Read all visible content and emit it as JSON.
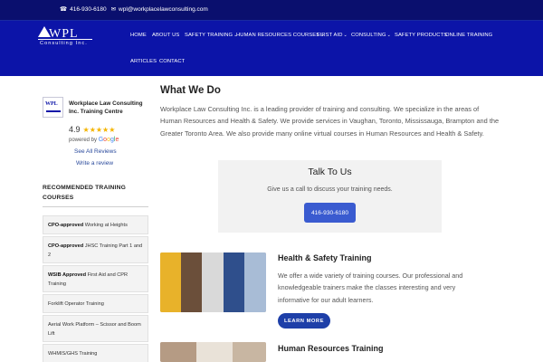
{
  "topbar": {
    "phone": "416-930-6180",
    "email": "wpl@workplacelawconsulting.com"
  },
  "logo": {
    "mark": "WPL",
    "subtitle": "Consulting Inc."
  },
  "nav": {
    "items": [
      {
        "label": "HOME"
      },
      {
        "label": "ABOUT US"
      },
      {
        "label": "SAFETY TRAINING"
      },
      {
        "label": "HUMAN RESOURCES COURSES"
      },
      {
        "label": "FIRST AID"
      },
      {
        "label": "CONSULTING"
      },
      {
        "label": "SAFETY PRODUCTS"
      },
      {
        "label": "ONLINE TRAINING"
      },
      {
        "label": "ARTICLES"
      },
      {
        "label": "CONTACT"
      }
    ]
  },
  "google_widget": {
    "business_name": "Workplace Law Consulting Inc. Training Centre",
    "rating": "4.9",
    "stars": "★★★★★",
    "powered_by": "powered by",
    "google": [
      "G",
      "o",
      "o",
      "g",
      "l",
      "e"
    ],
    "see_all": "See All Reviews",
    "write_review": "Write a review"
  },
  "sidebar": {
    "title": "RECOMMENDED TRAINING COURSES",
    "courses": [
      {
        "bold": "CPO-approved",
        "text": " Working at Heights"
      },
      {
        "bold": "CPO-approved",
        "text": " JHSC Training Part 1 and 2"
      },
      {
        "bold": "WSIB Approved",
        "text": " First Aid and CPR Training"
      },
      {
        "bold": "",
        "text": "Forklift Operator Training"
      },
      {
        "bold": "",
        "text": "Aerial Work Platform – Scissor and Boom Lift"
      },
      {
        "bold": "",
        "text": "WHMIS/GHS Training"
      }
    ]
  },
  "main": {
    "title": "What We Do",
    "intro": "Workplace Law Consulting Inc. is a leading provider of training and consulting. We specialize in the areas of Human Resources and Health & Safety. We provide services in Vaughan, Toronto, Mississauga, Brampton and the Greater Toronto Area. We also provide many online virtual courses in Human Resources and Health & Safety.",
    "talk": {
      "heading": "Talk To Us",
      "text": "Give us a call to discuss your training needs.",
      "button": "416-930-6180"
    },
    "services": [
      {
        "title": "Health & Safety Training",
        "description": "We offer a wide variety of training courses. Our professional and knowledgeable trainers make the classes interesting and very informative for our adult learners.",
        "button": "LEARN MORE"
      },
      {
        "title": "Human Resources Training"
      }
    ]
  },
  "colors": {
    "topbar": "#0a0f6e",
    "navbar": "#0c14a8",
    "button": "#3a5bd0",
    "learn_more": "#1e3fa8",
    "star": "#f4b400"
  }
}
